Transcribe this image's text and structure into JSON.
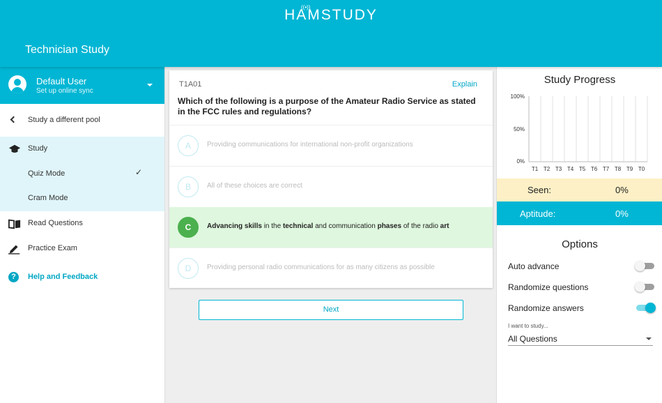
{
  "header": {
    "logo_text": "HAMSTUDY",
    "logo_antenna": "((•))",
    "title": "Technician Study"
  },
  "user": {
    "name": "Default User",
    "subtitle": "Set up online sync"
  },
  "sidebar": {
    "items": [
      {
        "label": "Study a different pool",
        "icon": "chevron-left-icon"
      },
      {
        "label": "Study",
        "icon": "graduation-cap-icon"
      },
      {
        "label": "Quiz Mode",
        "selected": true
      },
      {
        "label": "Cram Mode"
      },
      {
        "label": "Read Questions",
        "icon": "book-icon"
      },
      {
        "label": "Practice Exam",
        "icon": "pencil-icon"
      },
      {
        "label": "Help and Feedback",
        "icon": "help-icon"
      }
    ]
  },
  "question": {
    "id": "T1A01",
    "explain_label": "Explain",
    "text": "Which of the following is a purpose of the Amateur Radio Service as stated in the FCC rules and regulations?",
    "answers": [
      {
        "letter": "A",
        "text": "Providing communications for international non-profit organizations"
      },
      {
        "letter": "B",
        "text": "All of these choices are correct"
      },
      {
        "letter": "C",
        "parts": [
          "Advancing skills",
          " in the ",
          "technical",
          " and communication ",
          "phases",
          " of the radio ",
          "art"
        ],
        "correct": true
      },
      {
        "letter": "D",
        "text": "Providing personal radio communications for as many citizens as possible"
      }
    ],
    "next_label": "Next"
  },
  "progress": {
    "title": "Study Progress",
    "y_ticks": [
      "100%",
      "50%",
      "0%"
    ],
    "seen_label": "Seen:",
    "seen_value": "0%",
    "aptitude_label": "Aptitude:",
    "aptitude_value": "0%"
  },
  "chart_data": {
    "type": "bar",
    "categories": [
      "T1",
      "T2",
      "T3",
      "T4",
      "T5",
      "T6",
      "T7",
      "T8",
      "T9",
      "T0"
    ],
    "values": [
      0,
      0,
      0,
      0,
      0,
      0,
      0,
      0,
      0,
      0
    ],
    "ylim": [
      0,
      100
    ],
    "grid": true
  },
  "options": {
    "title": "Options",
    "auto_advance": {
      "label": "Auto advance",
      "on": false
    },
    "randomize_questions": {
      "label": "Randomize questions",
      "on": false
    },
    "randomize_answers": {
      "label": "Randomize answers",
      "on": true
    },
    "study_select_label": "I want to study...",
    "study_select_value": "All Questions"
  },
  "colors": {
    "accent": "#00b6d4",
    "correct": "#4bb04e",
    "seen_bg": "#fdf0c6"
  }
}
